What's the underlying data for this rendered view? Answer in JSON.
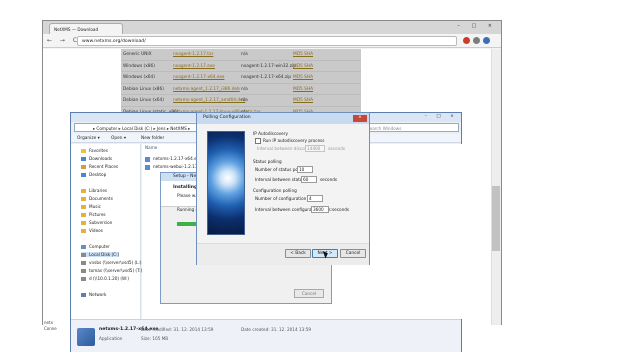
{
  "browser": {
    "tab_title": "NetXMS — Download",
    "url": "www.netxms.org/download/",
    "window_controls": "– □ ×",
    "nav_glyphs": "← → C",
    "ext_colors": [
      "#c83c2f",
      "#7d7d7d",
      "#3f6db3"
    ]
  },
  "download_table": {
    "rows": [
      [
        "Generic UNIX",
        "nxagent-1.2.17.tar",
        "n/a",
        "MD5 SHA"
      ],
      [
        "Windows (x86)",
        "nxagent-1.2.17.exe",
        "nxagent-1.2.17-win32.zip",
        "MD5 SHA"
      ],
      [
        "Windows (x64)",
        "nxagent-1.2.17-x64.exe",
        "nxagent-1.2.17-x64.zip",
        "MD5 SHA"
      ],
      [
        "Debian Linux (x86)",
        "netxms-agent_1.2.17_i386.deb",
        "n/a",
        "MD5 SHA"
      ],
      [
        "Debian Linux (x64)",
        "netxms-agent_1.2.17_amd64.deb",
        "n/a",
        "MD5 SHA"
      ],
      [
        "Debian Linux (static, x86)",
        "netxms-agent-1.2.17-linux-x86-static.tar",
        "n/a",
        "MD5 SHA"
      ],
      [
        "",
        "",
        "",
        ""
      ],
      [
        "",
        "",
        "",
        ""
      ]
    ]
  },
  "explorer": {
    "address": "▸ Computer ▸ Local Disk (C:) ▸ Jens ▸ NetXMS ▸",
    "search_placeholder": "Search Windows",
    "toolbar": {
      "organize": "Organize ▾",
      "open": "Open ▾",
      "new_folder": "New folder"
    },
    "nav_items": [
      {
        "label": "Favorites",
        "color": "#f0c040"
      },
      {
        "label": "Downloads",
        "color": "#4a86d0"
      },
      {
        "label": "Recent Places",
        "color": "#d0a030"
      },
      {
        "label": "Desktop",
        "color": "#4a86d0"
      },
      {
        "label": "Libraries",
        "color": "#e0b040"
      },
      {
        "label": "Documents",
        "color": "#e0b040"
      },
      {
        "label": "Music",
        "color": "#e0b040"
      },
      {
        "label": "Pictures",
        "color": "#e0b040"
      },
      {
        "label": "Subversion",
        "color": "#e0b040"
      },
      {
        "label": "Videos",
        "color": "#e0b040"
      },
      {
        "label": "Computer",
        "color": "#6a8fc0"
      },
      {
        "label": "Local Disk (C:)",
        "color": "#8a8a8a"
      },
      {
        "label": "vnsbs (\\\\server\\vsd5) (L:)",
        "color": "#8a8a8a"
      },
      {
        "label": "tomas (\\\\server\\vsd5) (T:)",
        "color": "#8a8a8a"
      },
      {
        "label": "d (\\\\10.0.1.20) (W:)",
        "color": "#8a8a8a"
      },
      {
        "label": "Network",
        "color": "#5a7fb0"
      }
    ],
    "file_header": "Name",
    "files": [
      "netxms-1.2.17-x64.exe",
      "netxms-webui-1.2.17-x64.exe"
    ],
    "status": {
      "name": "netxms-1.2.17-x64.exe",
      "type": "Application",
      "modified": "Date modified: 31. 12. 2014 13:59",
      "size": "Size: 105 MB",
      "created": "Date created: 31. 12. 2014 13:59"
    },
    "behind_label_1": "netx",
    "behind_label_2": "Conne",
    "caps": "– □ ×"
  },
  "setup": {
    "title": "Setup - NetXMS",
    "heading": "Installing",
    "subtitle": "Please wait while Setup installs NetXMS on your computer.",
    "running": "Running setup...",
    "progress": 0.17,
    "cancel": "Cancel",
    "close": "×"
  },
  "polling": {
    "title": "Polling Configuration",
    "close": "×",
    "ip_autodiscovery": "IP Autodiscovery",
    "run_autodiscovery": "Run IP autodiscovery process",
    "discovery_interval_label": "Interval between discovery polls",
    "discovery_interval_value": "14400",
    "discovery_unit": "seconds",
    "status_polling": "Status polling",
    "num_status_pollers_label": "Number of status pollers:",
    "num_status_pollers": "10",
    "status_interval_label": "Interval between status polls:",
    "status_interval": "60",
    "status_unit": "seconds",
    "config_polling": "Configuration polling",
    "num_config_pollers_label": "Number of configuration pollers:",
    "num_config_pollers": "4",
    "config_interval_label": "Interval between configuration polls:",
    "config_interval": "3600",
    "config_unit": "seconds",
    "back": "< Back",
    "next": "Next >",
    "cancel": "Cancel"
  }
}
